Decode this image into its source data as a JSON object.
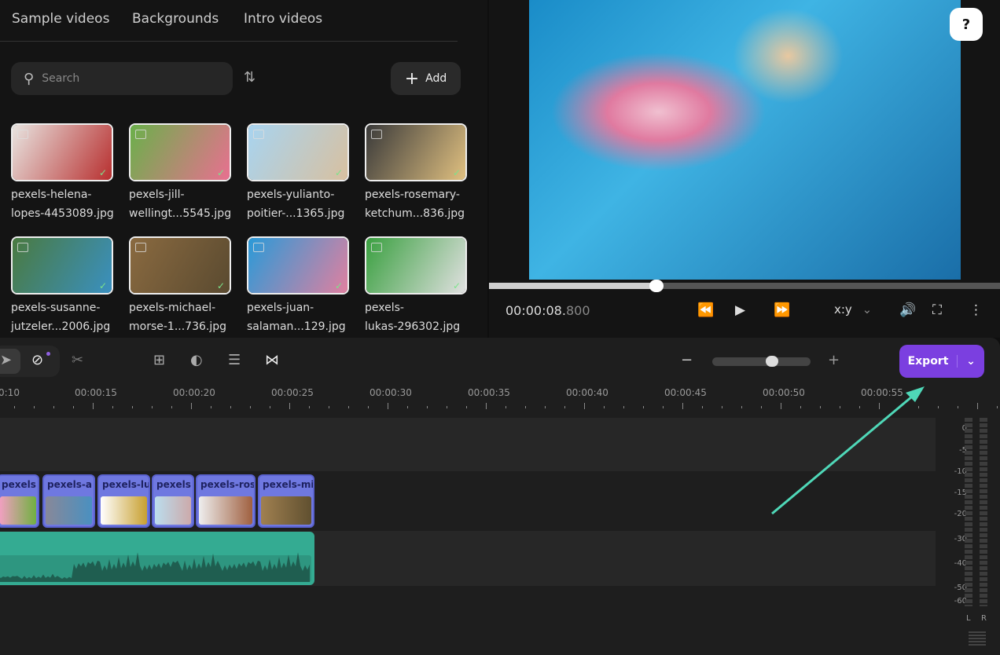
{
  "tabs": [
    "Sample videos",
    "Backgrounds",
    "Intro videos"
  ],
  "search": {
    "placeholder": "Search"
  },
  "add_label": "Add",
  "media": [
    {
      "line1": "pexels-helena-",
      "line2": "lopes-4453089.jpg",
      "colors": [
        "#e8e4e0",
        "#b83030"
      ]
    },
    {
      "line1": "pexels-jill-",
      "line2": "wellingt...5545.jpg",
      "colors": [
        "#6ab04a",
        "#e87090"
      ]
    },
    {
      "line1": "pexels-yulianto-",
      "line2": "poitier-...1365.jpg",
      "colors": [
        "#a8d4f0",
        "#d8c0a0"
      ]
    },
    {
      "line1": "pexels-rosemary-",
      "line2": "ketchum...836.jpg",
      "colors": [
        "#3a3a3a",
        "#e0c080"
      ]
    },
    {
      "line1": "pexels-susanne-",
      "line2": "jutzeler...2006.jpg",
      "colors": [
        "#4a7a40",
        "#3a90c0"
      ]
    },
    {
      "line1": "pexels-michael-",
      "line2": "morse-1...736.jpg",
      "colors": [
        "#8a6a40",
        "#5a4a30"
      ]
    },
    {
      "line1": "pexels-juan-",
      "line2": "salaman...129.jpg",
      "colors": [
        "#2a9ad8",
        "#e080a0"
      ]
    },
    {
      "line1": "pexels-",
      "line2": "lukas-296302.jpg",
      "colors": [
        "#3aa040",
        "#e0e0e0"
      ]
    }
  ],
  "player": {
    "time_main": "00:00:08.",
    "time_ms": "800",
    "aspect": "x:y",
    "progress_percent": 33
  },
  "export_label": "Export",
  "ruler": [
    "0:10",
    "00:00:15",
    "00:00:20",
    "00:00:25",
    "00:00:30",
    "00:00:35",
    "00:00:40",
    "00:00:45",
    "00:00:50",
    "00:00:55"
  ],
  "clips": [
    "pexels",
    "pexels-a",
    "pexels-lu",
    "pexels",
    "pexels-ros",
    "pexels-mi"
  ],
  "meter": {
    "db": [
      "0",
      "-5",
      "-10",
      "-15",
      "-20",
      "-30",
      "-40",
      "-50",
      "-60"
    ],
    "channels": [
      "L",
      "R"
    ]
  },
  "accent": "#7b3fe0",
  "arrow_color": "#4fd8b8"
}
